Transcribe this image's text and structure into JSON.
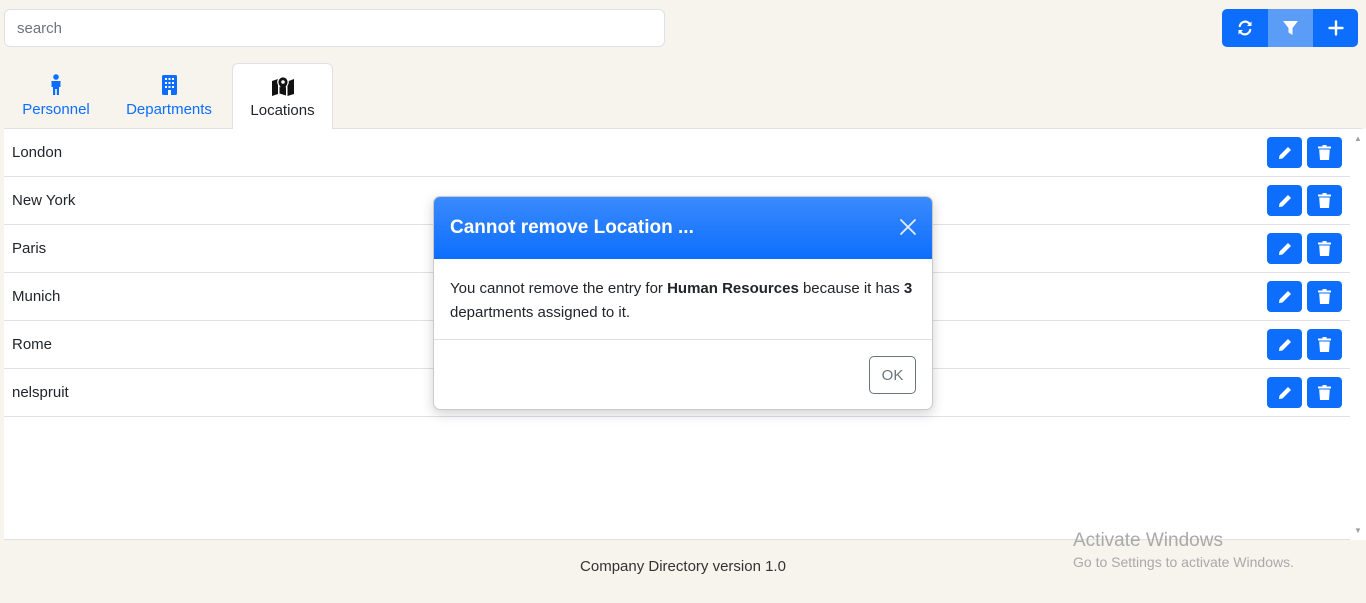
{
  "search": {
    "placeholder": "search",
    "value": ""
  },
  "toolbar": {
    "refresh_icon": "refresh-icon",
    "filter_icon": "filter-icon",
    "add_icon": "plus-icon",
    "accent": "#0d6efd"
  },
  "tabs": [
    {
      "label": "Personnel",
      "icon": "person-icon",
      "active": false
    },
    {
      "label": "Departments",
      "icon": "building-icon",
      "active": false
    },
    {
      "label": "Locations",
      "icon": "map-icon",
      "active": true
    }
  ],
  "locations": [
    {
      "name": "London"
    },
    {
      "name": "New York"
    },
    {
      "name": "Paris"
    },
    {
      "name": "Munich"
    },
    {
      "name": "Rome"
    },
    {
      "name": "nelspruit"
    }
  ],
  "modal": {
    "title": "Cannot remove Location ...",
    "text_before": "You cannot remove the entry for ",
    "entity": "Human Resources",
    "text_middle": " because it has ",
    "count": "3",
    "text_after": " departments assigned to it.",
    "ok_label": "OK"
  },
  "footer": {
    "text": "Company Directory version 1.0"
  },
  "watermark": {
    "line1": "Activate Windows",
    "line2": "Go to Settings to activate Windows."
  }
}
